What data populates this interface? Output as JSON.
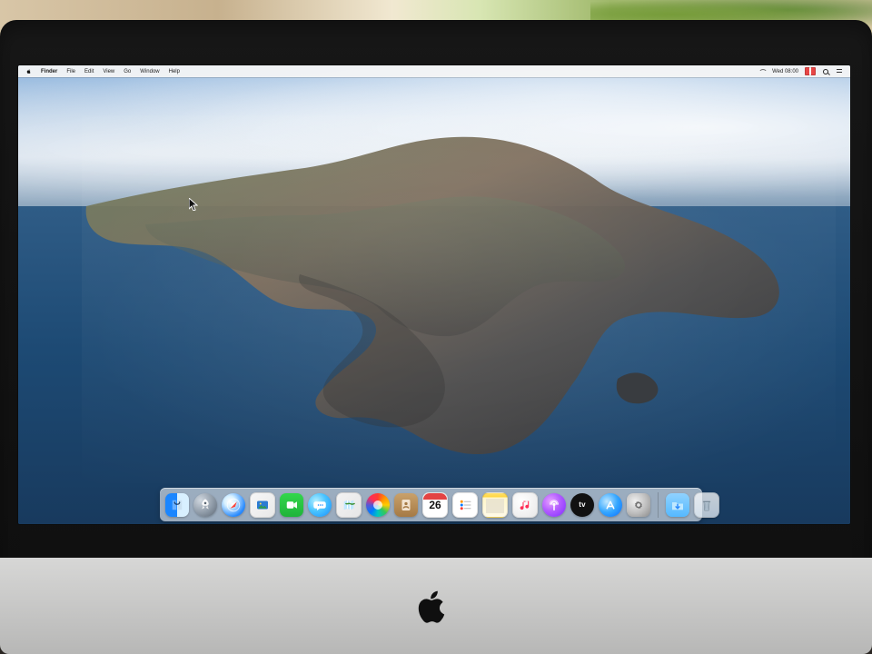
{
  "menubar": {
    "apple_menu_icon": "apple-icon",
    "app_name": "Finder",
    "menus": [
      "File",
      "Edit",
      "View",
      "Go",
      "Window",
      "Help"
    ],
    "clock": "Wed 08:00",
    "status_icons": [
      "wifi-icon",
      "language-flag-icon",
      "search-icon",
      "notification-center-icon"
    ]
  },
  "dock": {
    "items": [
      {
        "id": "finder",
        "icon": "finder-icon"
      },
      {
        "id": "launchpad",
        "icon": "launchpad-icon"
      },
      {
        "id": "safari",
        "icon": "safari-icon"
      },
      {
        "id": "photos-app",
        "icon": "photo-preview-icon"
      },
      {
        "id": "facetime",
        "icon": "facetime-icon"
      },
      {
        "id": "messages",
        "icon": "messages-icon"
      },
      {
        "id": "maps",
        "icon": "maps-icon"
      },
      {
        "id": "photos",
        "icon": "photos-icon"
      },
      {
        "id": "contacts",
        "icon": "contacts-icon"
      },
      {
        "id": "calendar",
        "icon": "calendar-icon",
        "calendar_day": "26"
      },
      {
        "id": "reminders",
        "icon": "reminders-icon"
      },
      {
        "id": "notes",
        "icon": "notes-icon"
      },
      {
        "id": "music",
        "icon": "music-icon"
      },
      {
        "id": "podcasts",
        "icon": "podcasts-icon"
      },
      {
        "id": "tv",
        "icon": "apple-tv-icon"
      },
      {
        "id": "app-store",
        "icon": "app-store-icon"
      },
      {
        "id": "system-preferences",
        "icon": "system-preferences-icon"
      }
    ],
    "right_items": [
      {
        "id": "downloads",
        "icon": "downloads-folder-icon"
      },
      {
        "id": "trash",
        "icon": "trash-icon"
      }
    ]
  }
}
